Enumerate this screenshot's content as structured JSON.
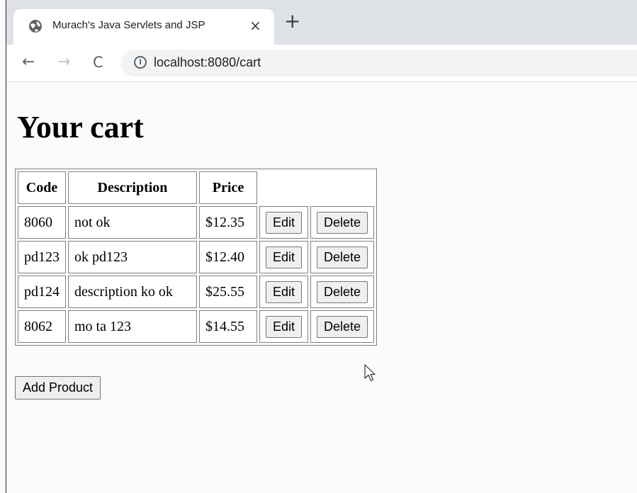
{
  "browser": {
    "tab_title": "Murach's Java Servlets and JSP",
    "tab_close": "×",
    "new_tab": "+",
    "url": "localhost:8080/cart",
    "back": "←",
    "forward": "→",
    "reload": "C",
    "info_icon": "i"
  },
  "page": {
    "heading": "Your cart",
    "columns": [
      "Code",
      "Description",
      "Price"
    ],
    "rows": [
      {
        "code": "8060",
        "description": "not ok",
        "price": "$12.35"
      },
      {
        "code": "pd123",
        "description": "ok pd123",
        "price": "$12.40"
      },
      {
        "code": "pd124",
        "description": "description ko ok",
        "price": "$25.55"
      },
      {
        "code": "8062",
        "description": "mo ta 123",
        "price": "$14.55"
      }
    ],
    "edit_label": "Edit",
    "delete_label": "Delete",
    "add_product_label": "Add Product"
  }
}
